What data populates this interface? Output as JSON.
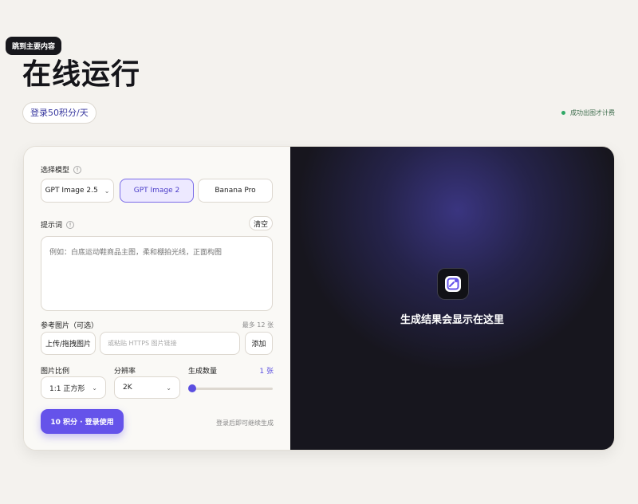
{
  "skip_link": "跳到主要内容",
  "page_title": "在线运行",
  "credits_pill": "登录50积分/天",
  "status_text": "成功出图才计费",
  "colors": {
    "accent": "#6553ea",
    "status": "#2fa866",
    "panel_dark": "#17161e"
  },
  "form": {
    "model_label": "选择模型",
    "models": [
      "GPT Image 2.5",
      "GPT Image 2",
      "Banana Pro"
    ],
    "selected_model": "GPT Image 2",
    "prompt_label": "提示词",
    "clear_label": "清空",
    "prompt_placeholder": "例如：白底运动鞋商品主图，柔和棚拍光线，正面构图",
    "ref_label": "参考图片（可选）",
    "ref_limit": "最多 12 张",
    "upload_label": "上传/拖拽图片",
    "url_placeholder": "或粘贴 HTTPS 图片链接",
    "add_label": "添加",
    "ratio_label": "图片比例",
    "ratio_value": "1:1 正方形",
    "resolution_label": "分辨率",
    "resolution_value": "2K",
    "count_label": "生成数量",
    "count_value": "1 张",
    "count_fraction": 0.0,
    "submit_label": "10 积分 · 登录使用",
    "login_hint": "登录后即可继续生成"
  },
  "result": {
    "icon": "image-icon",
    "placeholder": "生成结果会显示在这里"
  }
}
